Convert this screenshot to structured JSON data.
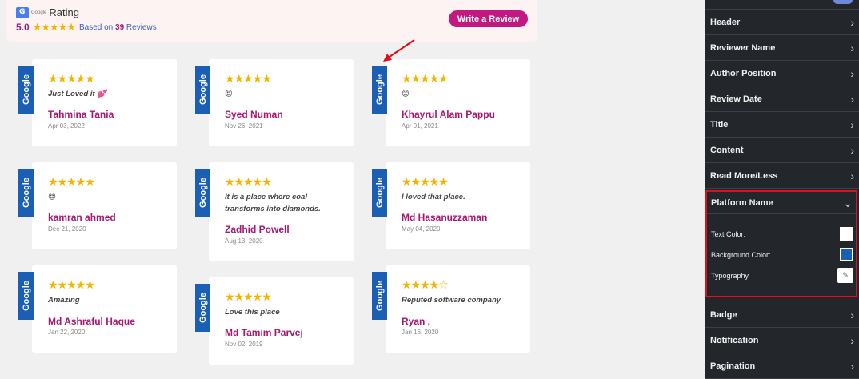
{
  "header": {
    "google_word": "Google",
    "rating_label": "Rating",
    "score": "5.0",
    "stars": "★★★★★",
    "based_on_prefix": "Based on",
    "review_count": "39",
    "based_on_suffix": "Reviews",
    "write_review_label": "Write a Review"
  },
  "reviews": [
    {
      "platform": "Google",
      "stars": "★★★★★",
      "text": "Just Loved it 💕",
      "name": "Tahmina Tania",
      "date": "Apr 03, 2022"
    },
    {
      "platform": "Google",
      "stars": "★★★★★",
      "text": "😍",
      "name": "Syed Numan",
      "date": "Nov 26, 2021"
    },
    {
      "platform": "Google",
      "stars": "★★★★★",
      "text": "😊",
      "name": "Khayrul Alam Pappu",
      "date": "Apr 01, 2021"
    },
    {
      "platform": "Google",
      "stars": "★★★★★",
      "text": "😍",
      "name": "kamran ahmed",
      "date": "Dec 21, 2020"
    },
    {
      "platform": "Google",
      "stars": "★★★★★",
      "text": "It is a place where coal transforms into diamonds.",
      "name": "Zadhid Powell",
      "date": "Aug 13, 2020"
    },
    {
      "platform": "Google",
      "stars": "★★★★★",
      "text": "I loved that place.",
      "name": "Md Hasanuzzaman",
      "date": "May 04, 2020"
    },
    {
      "platform": "Google",
      "stars": "★★★★★",
      "text": "Amazing",
      "name": "Md Ashraful Haque",
      "date": "Jan 22, 2020"
    },
    {
      "platform": "Google",
      "stars": "★★★★★",
      "text": "Love this place",
      "name": "Md Tamim Parvej",
      "date": "Nov 02, 2019"
    },
    {
      "platform": "Google",
      "stars": "★★★★☆",
      "text": "Reputed software company",
      "name": "Ryan ,",
      "date": "Jan 16, 2020"
    }
  ],
  "panel": {
    "items_above": [
      "Header",
      "Reviewer Name",
      "Author Position",
      "Review Date",
      "Title",
      "Content",
      "Read More/Less"
    ],
    "section_title": "Platform Name",
    "controls": {
      "text_color_label": "Text Color:",
      "text_color": "#ffffff",
      "bg_color_label": "Background Color:",
      "bg_color": "#1a5fb4",
      "typography_label": "Typography"
    },
    "items_below": [
      "Badge",
      "Notification",
      "Pagination"
    ]
  },
  "colors": {
    "accent": "#c41881",
    "name_color": "#a8186e",
    "star_color": "#f5b301",
    "google_tag": "#1a5fb4",
    "highlight": "#e0101a"
  }
}
